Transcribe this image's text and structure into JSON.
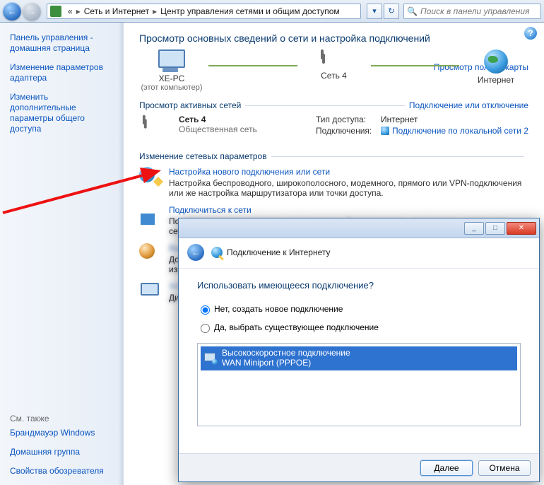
{
  "toolbar": {
    "back_glyph": "←",
    "fwd_glyph": "→",
    "down_glyph": "▾",
    "refresh_glyph": "↻",
    "breadcrumb": {
      "seg1": "Сеть и Интернет",
      "seg2": "Центр управления сетями и общим доступом",
      "sep": "▸"
    },
    "search_placeholder": "Поиск в панели управления",
    "search_glyph": "🔍"
  },
  "sidebar": {
    "home": "Панель управления - домашняя страница",
    "adapter": "Изменение параметров адаптера",
    "sharing": "Изменить дополнительные параметры общего доступа",
    "see_also": "См. также",
    "firewall": "Брандмауэр Windows",
    "homegroup": "Домашняя группа",
    "inetopts": "Свойства обозревателя"
  },
  "content": {
    "title": "Просмотр основных сведений о сети и настройка подключений",
    "map_link": "Просмотр полной карты",
    "diag": {
      "pc_name": "XE-PC",
      "pc_sub": "(этот компьютер)",
      "net_name": "Сеть 4",
      "inet": "Интернет"
    },
    "active_head": "Просмотр активных сетей",
    "active_link": "Подключение или отключение",
    "active": {
      "name": "Сеть 4",
      "type": "Общественная сеть",
      "lbl_access": "Тип доступа:",
      "val_access": "Интернет",
      "lbl_conn": "Подключения:",
      "val_conn": "Подключение по локальной сети 2"
    },
    "params_head": "Изменение сетевых параметров",
    "tasks": [
      {
        "link": "Настройка нового подключения или сети",
        "desc": "Настройка беспроводного, широкополосного, модемного, прямого или VPN-подключения или же настройка маршрутизатора или точки доступа."
      },
      {
        "link": "Подключиться к сети",
        "desc": "Подключение или повторное подключение к беспроводному, проводному, модемному сетевому соединению или подключению VPN."
      },
      {
        "link": "Выбор домашней группы и параметров общего доступа",
        "desc": "Доступ к файлам и принтерам, расположенным на других сетевых компьютерах, или изменение параметров общего доступа."
      },
      {
        "link": "Устранение неполадок",
        "desc": "Диагностика и исправление сетевых проблем или получение сведений об устранении."
      }
    ]
  },
  "modal": {
    "wizard_title": "Подключение к Интернету",
    "question": "Использовать имеющееся подключение?",
    "opt_new": "Нет, создать новое подключение",
    "opt_existing": "Да, выбрать существующее подключение",
    "item_title": "Высокоскоростное подключение",
    "item_sub": "WAN Miniport (PPPOE)",
    "btn_next": "Далее",
    "btn_cancel": "Отмена",
    "min_glyph": "_",
    "max_glyph": "□",
    "close_glyph": "✕",
    "back_glyph": "←"
  },
  "help_glyph": "?"
}
